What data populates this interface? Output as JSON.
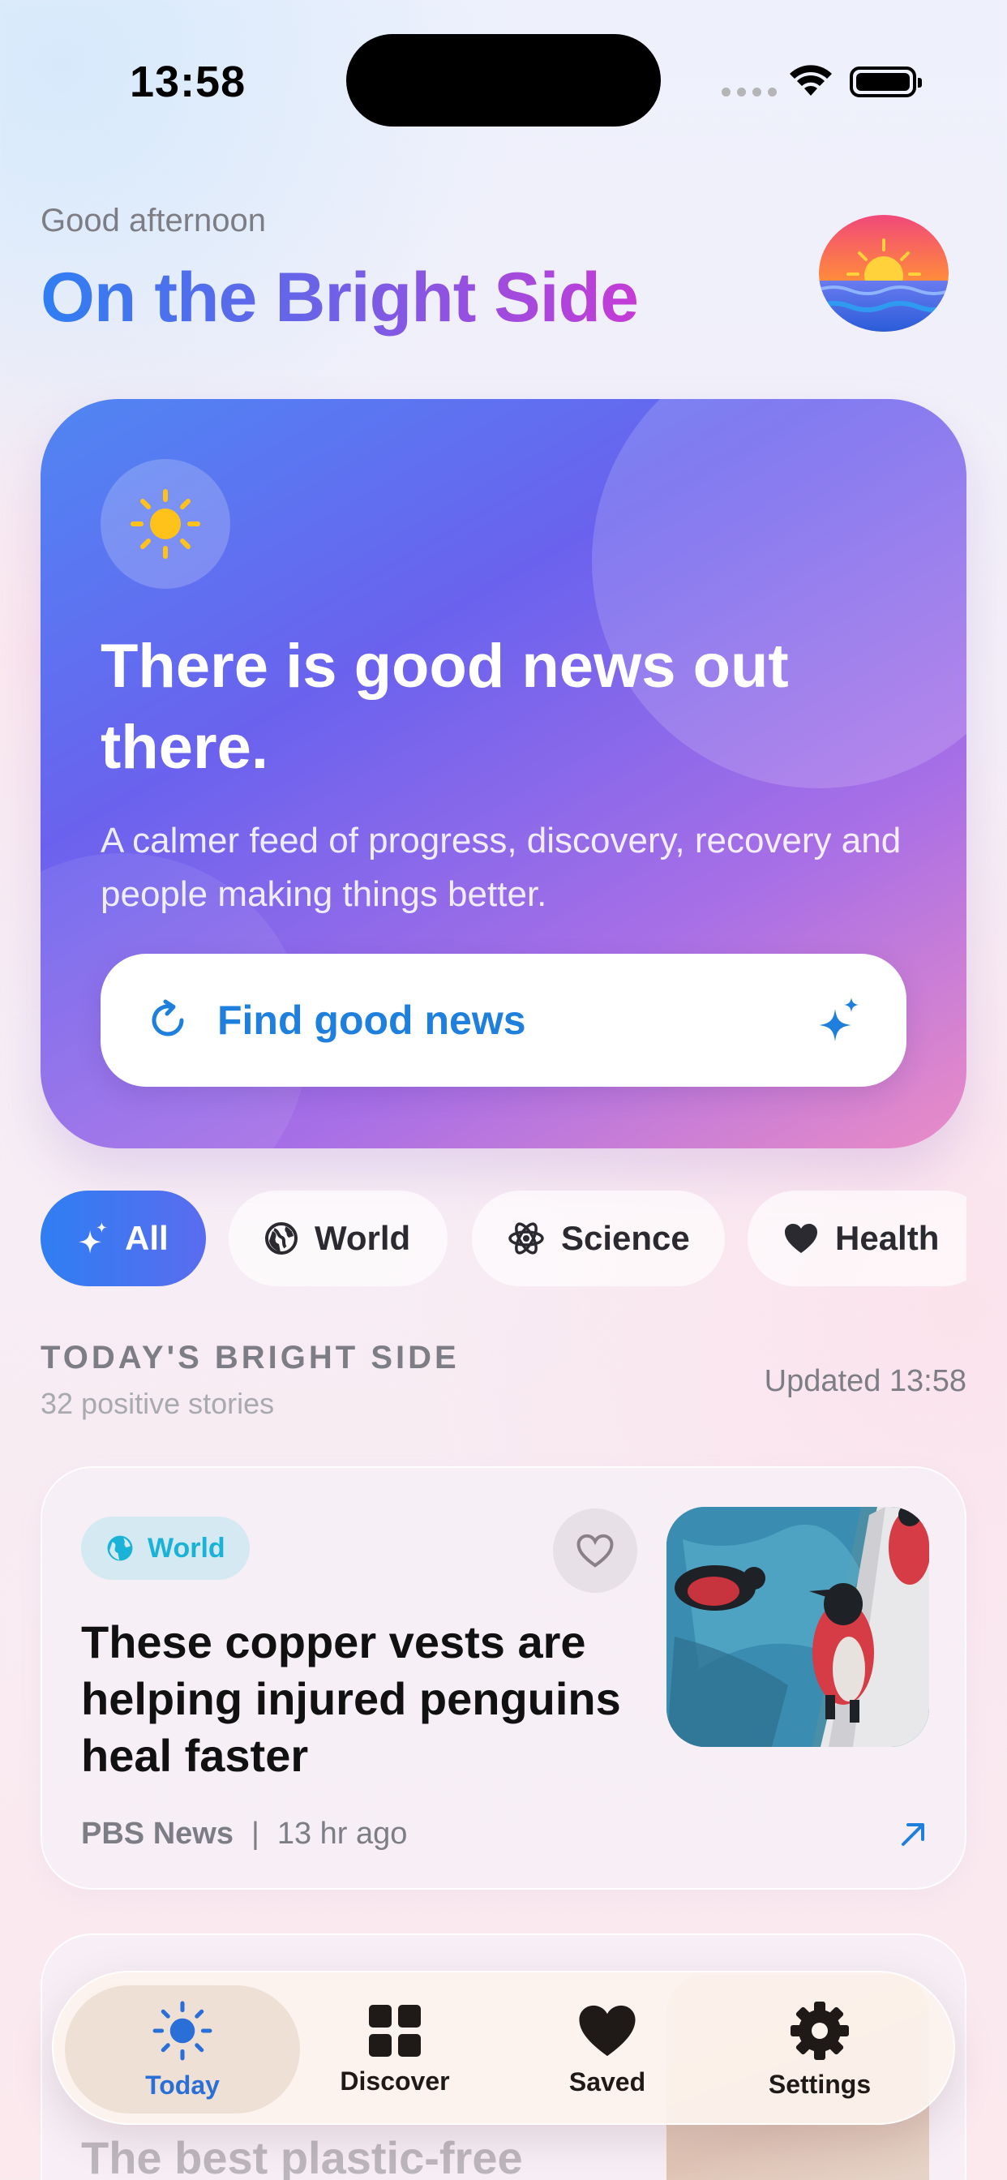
{
  "status_bar": {
    "time": "13:58"
  },
  "header": {
    "greeting": "Good afternoon",
    "title": "On the Bright Side"
  },
  "hero": {
    "title": "There is good news out there.",
    "subtitle": "A calmer feed of progress, discovery, recovery and people making things better.",
    "button_label": "Find good news"
  },
  "filters": [
    {
      "label": "All",
      "icon": "sparkles-icon",
      "active": true
    },
    {
      "label": "World",
      "icon": "globe-icon",
      "active": false
    },
    {
      "label": "Science",
      "icon": "atom-icon",
      "active": false
    },
    {
      "label": "Health",
      "icon": "heart-icon",
      "active": false
    }
  ],
  "section": {
    "title": "TODAY'S BRIGHT SIDE",
    "count": "32 positive stories",
    "updated": "Updated 13:58"
  },
  "stories": [
    {
      "category": "World",
      "title": "These copper vests are helping injured penguins heal faster",
      "source": "PBS News",
      "separator": "|",
      "age": "13 hr ago"
    },
    {
      "title": "The best plastic-free cutting boards: I spent"
    }
  ],
  "tabbar": [
    {
      "label": "Today",
      "icon": "sun-icon",
      "active": true
    },
    {
      "label": "Discover",
      "icon": "grid-icon",
      "active": false
    },
    {
      "label": "Saved",
      "icon": "heart-icon",
      "active": false
    },
    {
      "label": "Settings",
      "icon": "gear-icon",
      "active": false
    }
  ],
  "colors": {
    "accent": "#1e7fdc",
    "tag_world": "#1ab3d7",
    "chip_active": "#2f7ef2"
  }
}
